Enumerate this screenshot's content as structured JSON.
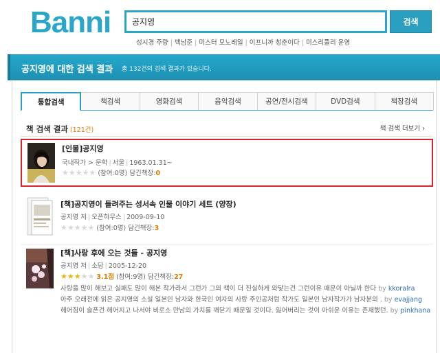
{
  "header": {
    "logo_text": "Banni",
    "search_value": "공지영",
    "search_button": "검색",
    "popular": [
      "성시경 주량",
      "백남준",
      "미스터 모노레일",
      "이프니까 청춘이다",
      "미스리플리 운영"
    ]
  },
  "banner": {
    "query_title": "공지영에 대한 검색 결과",
    "count_text": "총 132건의 검색 결과가 있습니다."
  },
  "tabs": [
    "통합검색",
    "책검색",
    "영화검색",
    "음악검색",
    "공연/전시검색",
    "DVD검색",
    "책장검색"
  ],
  "section": {
    "title": "책 검색 결과",
    "count": "(121건)",
    "more": "책 검색 더보기 ›"
  },
  "results": [
    {
      "title": "[인물]공지영",
      "meta": [
        "국내작가 > 문학",
        "서울",
        "1963.01.31~"
      ],
      "rating": "",
      "participants": "(참여:0명)",
      "shelf_label": "담긴책장:",
      "shelf_count": "0",
      "stars_filled": 0
    },
    {
      "title": "[책]공지영이 들려주는 성서속 인물 이야기 세트 (양장)",
      "meta": [
        "공지영 저",
        "오픈하우스",
        "2009-09-10"
      ],
      "rating": "",
      "participants": "(참여:0명)",
      "shelf_label": "담긴책장:",
      "shelf_count": "3",
      "stars_filled": 0
    },
    {
      "title": "[책]사랑 후에 오는 것들 - 공지영",
      "meta": [
        "공지영 저",
        "소담",
        "2005-12-20"
      ],
      "rating": "3.1점",
      "participants": "(참여:9명)",
      "shelf_label": "담긴책장:",
      "shelf_count": "27",
      "stars_filled": 3,
      "reviews": [
        {
          "text": "사랑을 많이 해보고 실패도 많이 해본 작가라서 그런가 그의 책이 더 진실하게 와닿는건 그런이유 때문이 아닐까 한다",
          "by": "by",
          "user": "kkoralra"
        },
        {
          "text": "아주 오래전에 읽은 공지영의 소설 일본인 남자와 한국인 여자의 사랑 주인공처럼 작가도 일본인 남자작가가 남자분의 .",
          "by": "by",
          "user": "evajjang"
        },
        {
          "text": "헤어짐이 슬픈건 헤어지고 나서야 비로소 만남의 가치를 깨닫기 때문일 것이다. 잃어버리는 것이 아쉬운 이유는 존재했던.",
          "by": "by",
          "user": "pinkhana"
        }
      ]
    }
  ]
}
